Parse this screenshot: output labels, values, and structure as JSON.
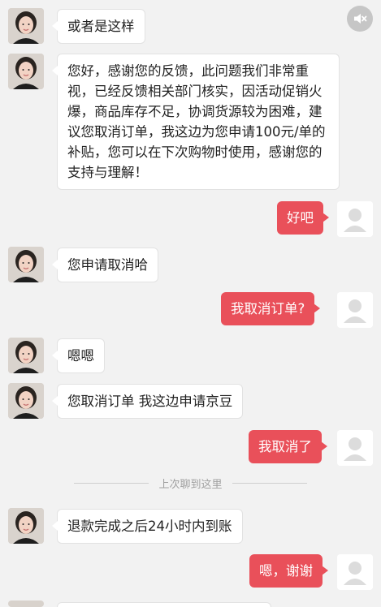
{
  "icons": {
    "mute": "speaker-mute-icon",
    "agent_avatar": "agent-avatar",
    "user_avatar": "user-placeholder-avatar"
  },
  "colors": {
    "background": "#f2f2f2",
    "user_bubble": "#e9505a",
    "agent_bubble": "#ffffff",
    "divider_text": "#a0a0a0"
  },
  "messages": [
    {
      "sender": "agent",
      "text": "或者是这样"
    },
    {
      "sender": "agent",
      "text": "您好，感谢您的反馈，此问题我们非常重视，已经反馈相关部门核实，因活动促销火爆，商品库存不足，协调货源较为困难，建议您取消订单，我这边为您申请100元/单的补贴，您可以在下次购物时使用，感谢您的支持与理解！"
    },
    {
      "sender": "user",
      "text": "好吧"
    },
    {
      "sender": "agent",
      "text": "您申请取消哈"
    },
    {
      "sender": "user",
      "text": "我取消订单?"
    },
    {
      "sender": "agent",
      "text": "嗯嗯"
    },
    {
      "sender": "agent",
      "text": "您取消订单 我这边申请京豆"
    },
    {
      "sender": "user",
      "text": "我取消了"
    },
    {
      "sender": "agent",
      "text": "退款完成之后24小时内到账"
    },
    {
      "sender": "user",
      "text": "嗯，谢谢"
    }
  ],
  "divider": {
    "text": "上次聊到这里"
  }
}
